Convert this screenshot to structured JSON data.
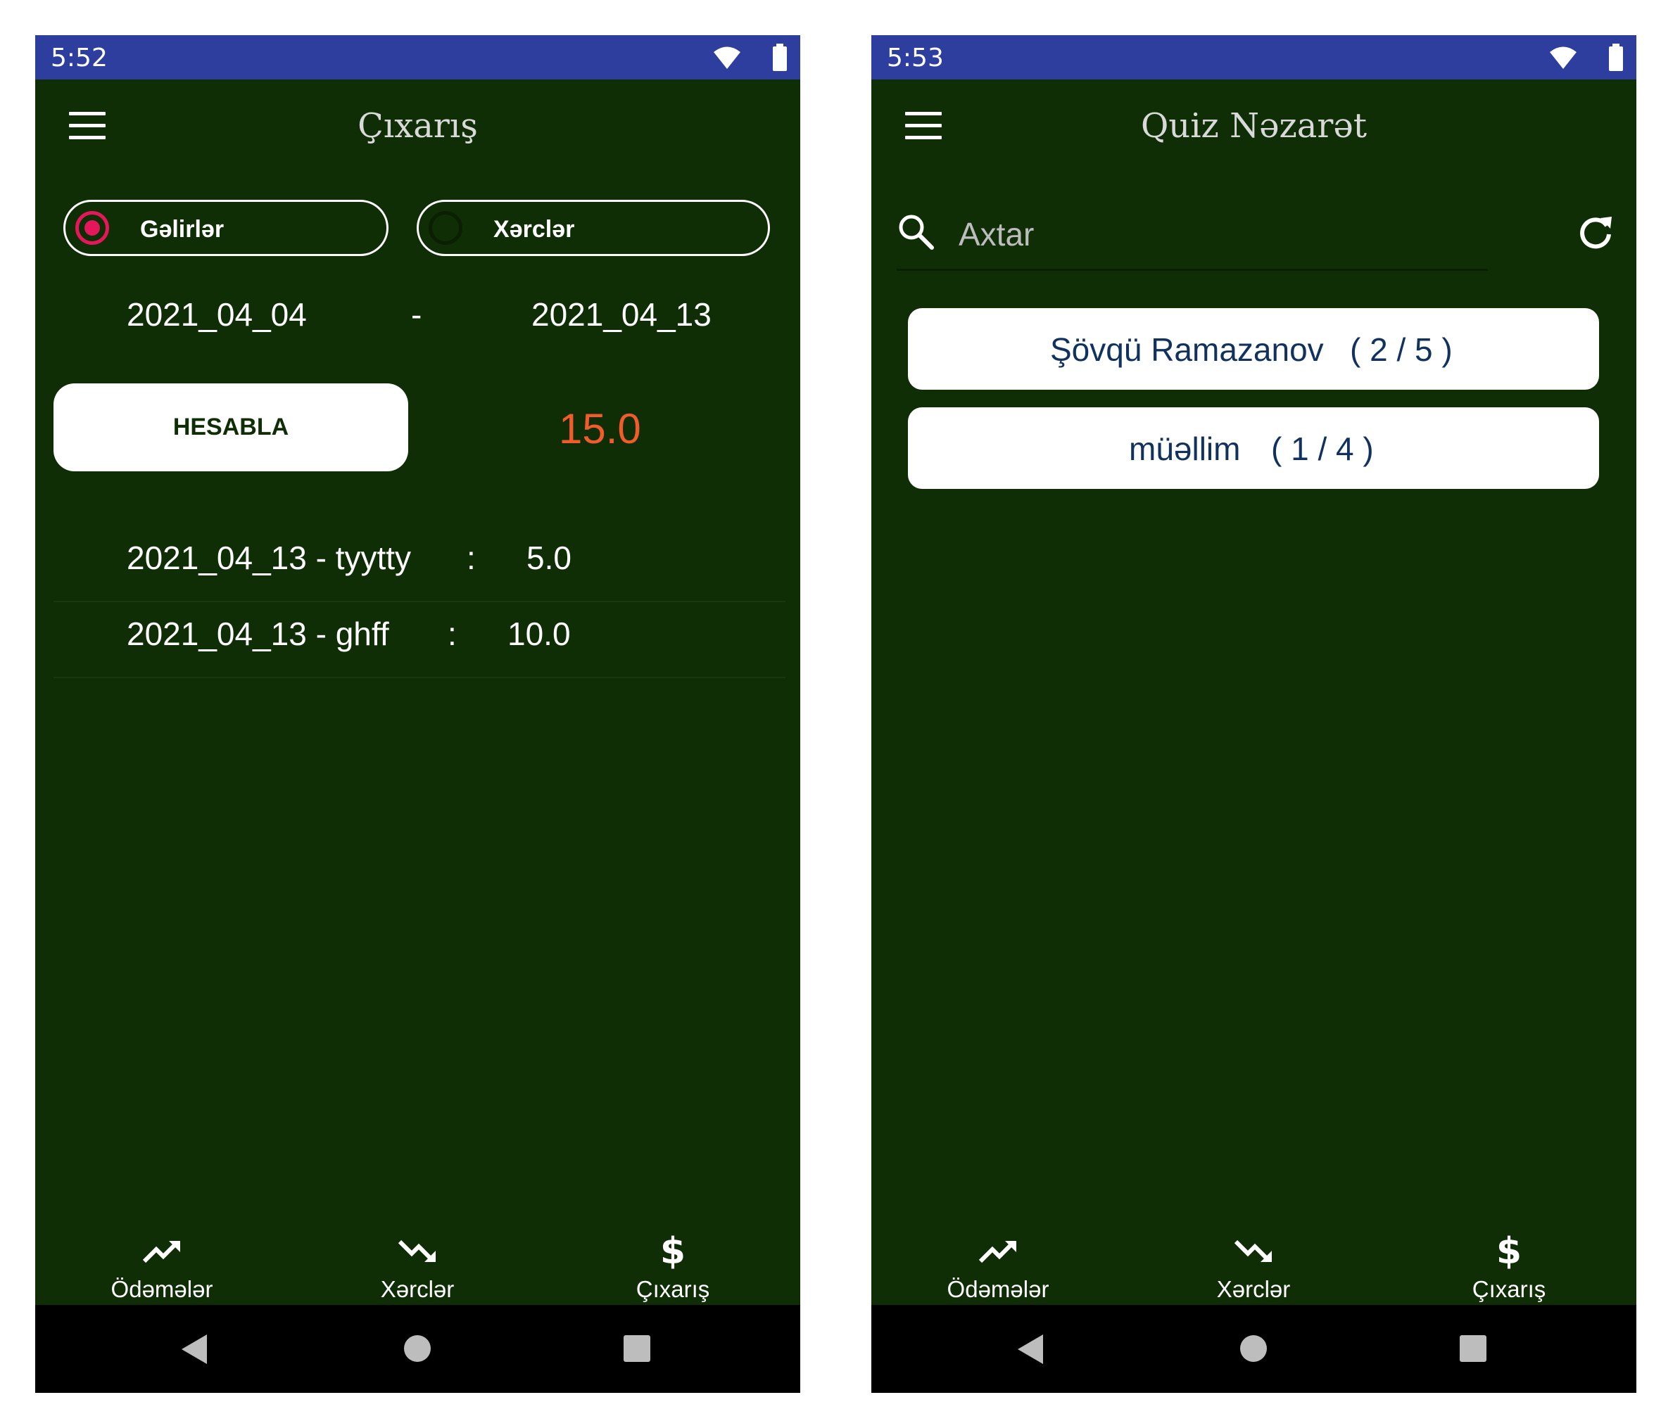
{
  "left_screen": {
    "status": {
      "time": "5:52"
    },
    "app_bar": {
      "title": "Çıxarış"
    },
    "filters": {
      "income_label": "Gəlirlər",
      "expense_label": "Xərclər",
      "selected": "income"
    },
    "date_range": {
      "from": "2021_04_04",
      "separator": "-",
      "to": "2021_04_13"
    },
    "calc_button_label": "HESABLA",
    "total": "15.0",
    "entries": [
      {
        "label": "2021_04_13 - tyytty",
        "colon": ":",
        "amount": "5.0"
      },
      {
        "label": "2021_04_13 - ghff",
        "colon": ":",
        "amount": "10.0"
      }
    ],
    "bottom_nav": [
      {
        "label": "Ödəmələr",
        "icon": "trending-up-icon"
      },
      {
        "label": "Xərclər",
        "icon": "trending-down-icon"
      },
      {
        "label": "Çıxarış",
        "icon": "dollar-icon"
      }
    ]
  },
  "right_screen": {
    "status": {
      "time": "5:53"
    },
    "app_bar": {
      "title": "Quiz Nəzarət"
    },
    "search": {
      "placeholder": "Axtar",
      "value": ""
    },
    "quizzes": [
      {
        "name": "Şövqü Ramazanov",
        "score": "( 2 / 5 )"
      },
      {
        "name": "müəllim",
        "score": "( 1 / 4 )"
      }
    ],
    "bottom_nav": [
      {
        "label": "Ödəmələr",
        "icon": "trending-up-icon"
      },
      {
        "label": "Xərclər",
        "icon": "trending-down-icon"
      },
      {
        "label": "Çıxarış",
        "icon": "dollar-icon"
      }
    ]
  },
  "colors": {
    "background": "#0f2e06",
    "status_bar": "#2d3e9f",
    "accent_radio": "#e4175a",
    "total_value": "#f25c2a",
    "card_text": "#11315e"
  }
}
